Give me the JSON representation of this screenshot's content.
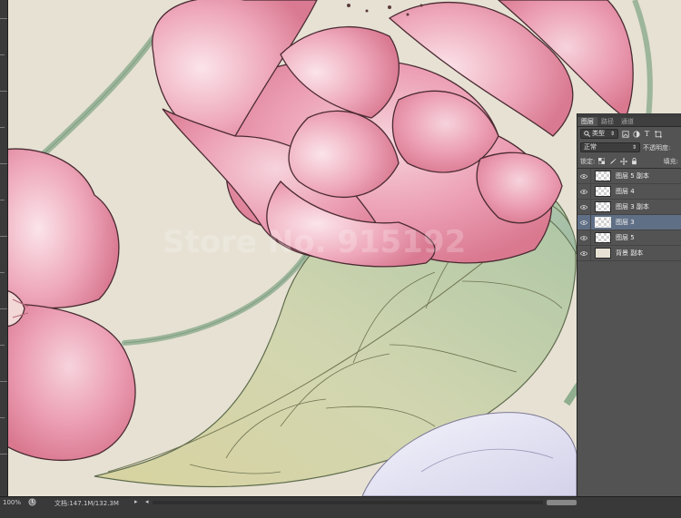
{
  "status": {
    "zoom": "100%",
    "doc_info": "文档:147.1M/132.3M",
    "arrow": "▸",
    "nav_left": "◂"
  },
  "watermark": {
    "text": "Store No. 915192"
  },
  "layers_panel": {
    "tabs": [
      "图层",
      "路径",
      "通道"
    ],
    "filter": {
      "label": "类型",
      "icon": "search-icon"
    },
    "blend_mode": "正常",
    "opacity_label": "不透明度:",
    "lock_label": "锁定:",
    "fill_label": "填充:",
    "layers": [
      {
        "name": "图层 5 副本",
        "selected": false,
        "visible": true
      },
      {
        "name": "图层 4",
        "selected": false,
        "visible": true
      },
      {
        "name": "图层 3 副本",
        "selected": false,
        "visible": true
      },
      {
        "name": "图层 3",
        "selected": true,
        "visible": true
      },
      {
        "name": "图层 5",
        "selected": false,
        "visible": true
      },
      {
        "name": "背景 副本",
        "selected": false,
        "visible": true
      }
    ]
  },
  "colors": {
    "canvas_bg": "#e6e1d3",
    "petal_pink": "#e7a3b5",
    "leaf_green": "#b9c9a8",
    "stem_green": "#8fae8f",
    "panel_bg": "#535353",
    "selection": "#5f6f86"
  }
}
